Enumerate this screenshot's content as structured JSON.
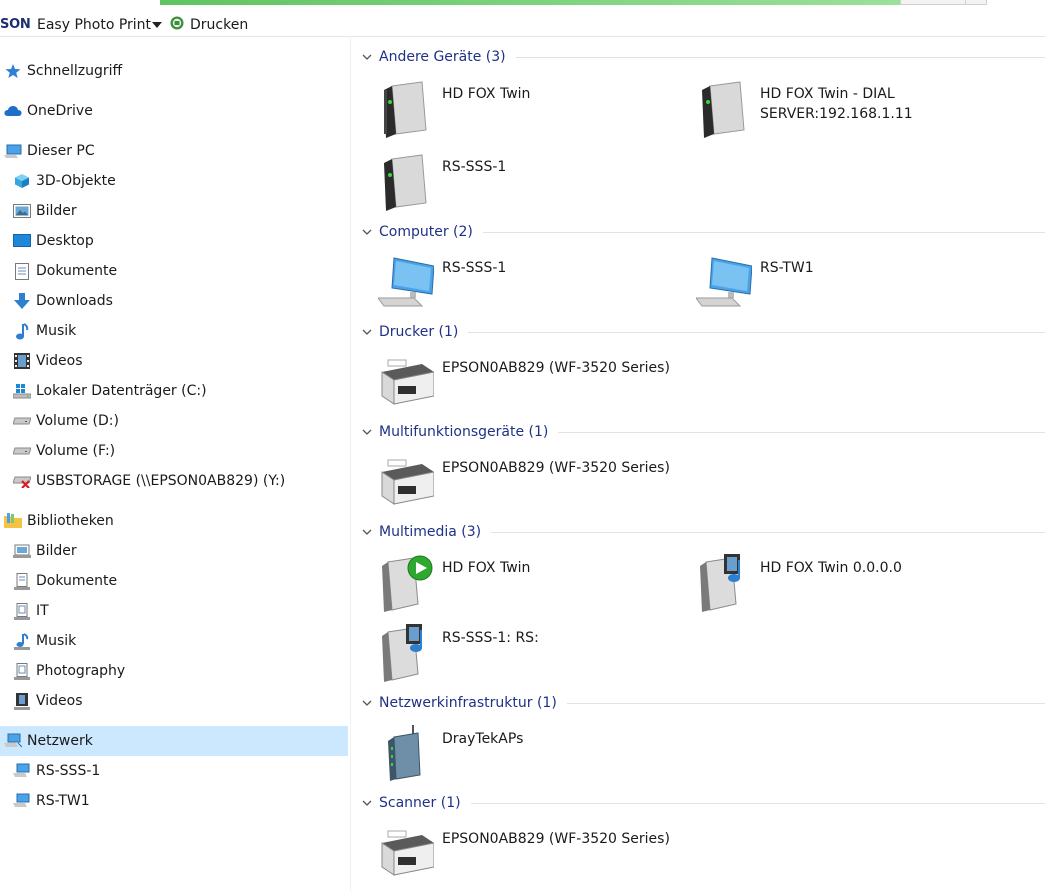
{
  "toolbar": {
    "brand": "SON",
    "app_label": "Easy Photo Print",
    "print_label": "Drucken"
  },
  "sidebar": {
    "items": [
      {
        "label": "Schnellzugriff",
        "icon": "star-icon"
      },
      {
        "label": "OneDrive",
        "icon": "cloud-icon"
      },
      {
        "label": "Dieser PC",
        "icon": "computer-icon"
      },
      {
        "label": "3D-Objekte",
        "icon": "cube-icon"
      },
      {
        "label": "Bilder",
        "icon": "pictures-icon"
      },
      {
        "label": "Desktop",
        "icon": "desktop-icon"
      },
      {
        "label": "Dokumente",
        "icon": "document-icon"
      },
      {
        "label": "Downloads",
        "icon": "download-arrow-icon"
      },
      {
        "label": "Musik",
        "icon": "music-note-icon"
      },
      {
        "label": "Videos",
        "icon": "film-icon"
      },
      {
        "label": "Lokaler Datenträger (C:)",
        "icon": "windows-drive-icon"
      },
      {
        "label": "Volume (D:)",
        "icon": "drive-icon"
      },
      {
        "label": "Volume (F:)",
        "icon": "drive-icon"
      },
      {
        "label": "USBSTORAGE (\\\\EPSON0AB829) (Y:)",
        "icon": "disconnected-drive-icon"
      },
      {
        "label": "Bibliotheken",
        "icon": "library-folder-icon"
      },
      {
        "label": "Bilder",
        "icon": "pictures-icon"
      },
      {
        "label": "Dokumente",
        "icon": "document-icon"
      },
      {
        "label": "IT",
        "icon": "library-doc-icon"
      },
      {
        "label": "Musik",
        "icon": "music-note-icon"
      },
      {
        "label": "Photography",
        "icon": "library-doc-icon"
      },
      {
        "label": "Videos",
        "icon": "film-icon"
      },
      {
        "label": "Netzwerk",
        "icon": "network-icon"
      },
      {
        "label": "RS-SSS-1",
        "icon": "computer-icon"
      },
      {
        "label": "RS-TW1",
        "icon": "computer-icon"
      }
    ]
  },
  "groups": [
    {
      "title": "Andere Geräte (3)",
      "items": [
        {
          "name": "HD FOX Twin",
          "icon": "device-tower-icon"
        },
        {
          "name": "HD FOX Twin - DIAL\nSERVER:192.168.1.11",
          "icon": "device-tower-icon"
        },
        {
          "name": "RS-SSS-1",
          "icon": "device-tower-icon"
        }
      ]
    },
    {
      "title": "Computer (2)",
      "items": [
        {
          "name": "RS-SSS-1",
          "icon": "monitor-keyboard-icon"
        },
        {
          "name": "RS-TW1",
          "icon": "monitor-keyboard-icon"
        }
      ]
    },
    {
      "title": "Drucker (1)",
      "items": [
        {
          "name": "EPSON0AB829 (WF-3520 Series)",
          "icon": "printer-icon"
        }
      ]
    },
    {
      "title": "Multifunktionsgeräte (1)",
      "items": [
        {
          "name": "EPSON0AB829 (WF-3520 Series)",
          "icon": "printer-icon"
        }
      ]
    },
    {
      "title": "Multimedia (3)",
      "items": [
        {
          "name": "HD FOX Twin",
          "icon": "media-play-device-icon"
        },
        {
          "name": "HD FOX Twin 0.0.0.0",
          "icon": "media-server-icon"
        },
        {
          "name": "RS-SSS-1: RS:",
          "icon": "media-server-icon"
        }
      ]
    },
    {
      "title": "Netzwerkinfrastruktur (1)",
      "items": [
        {
          "name": "DrayTekAPs",
          "icon": "router-icon"
        }
      ]
    },
    {
      "title": "Scanner (1)",
      "items": [
        {
          "name": "EPSON0AB829 (WF-3520 Series)",
          "icon": "printer-icon"
        }
      ]
    }
  ],
  "colors": {
    "group_title": "#1e3287",
    "selected_background": "#cce8ff"
  }
}
